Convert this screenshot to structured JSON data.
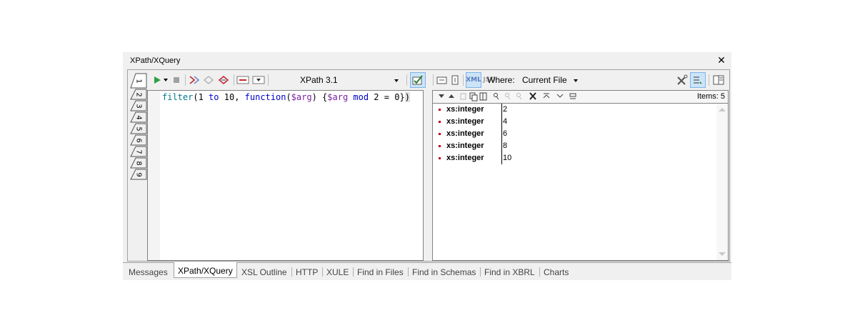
{
  "panel": {
    "title": "XPath/XQuery",
    "close_glyph": "✕"
  },
  "vertical_tabs": [
    "1",
    "2",
    "3",
    "4",
    "5",
    "6",
    "7",
    "8",
    "9"
  ],
  "left_toolbar": {
    "version_select": "XPath 3.1",
    "icons": [
      "run-icon",
      "run-dropdown-icon",
      "stop-icon",
      "step-into-icon",
      "step-over-icon",
      "step-out-icon",
      "builder-mode-icon",
      "evaluator-mode-icon",
      "validate-icon"
    ]
  },
  "editor": {
    "code_tokens": [
      {
        "t": "filter",
        "c": "kw"
      },
      {
        "t": "(",
        "c": "pl"
      },
      {
        "t": "1",
        "c": "num"
      },
      {
        "t": " to ",
        "c": "blue"
      },
      {
        "t": "10",
        "c": "num"
      },
      {
        "t": ", ",
        "c": "pl"
      },
      {
        "t": "function",
        "c": "blue"
      },
      {
        "t": "(",
        "c": "pl"
      },
      {
        "t": "$arg",
        "c": "var"
      },
      {
        "t": ") {",
        "c": "pl"
      },
      {
        "t": "$arg",
        "c": "var"
      },
      {
        "t": " mod ",
        "c": "blue"
      },
      {
        "t": "2",
        "c": "num"
      },
      {
        "t": " = ",
        "c": "pl"
      },
      {
        "t": "0",
        "c": "num"
      },
      {
        "t": "}",
        "c": "pl"
      },
      {
        "t": ")",
        "c": "brk"
      }
    ]
  },
  "right_toolbar": {
    "xml_label": "XML",
    "json_label": "JSO",
    "where_label": "Where:",
    "where_value": "Current File"
  },
  "results": {
    "items_label": "Items: 5",
    "rows": [
      {
        "type": "xs:integer",
        "value": "2"
      },
      {
        "type": "xs:integer",
        "value": "4"
      },
      {
        "type": "xs:integer",
        "value": "6"
      },
      {
        "type": "xs:integer",
        "value": "8"
      },
      {
        "type": "xs:integer",
        "value": "10"
      }
    ]
  },
  "bottom_tabs": [
    "Messages",
    "XPath/XQuery",
    "XSL Outline",
    "HTTP",
    "XULE",
    "Find in Files",
    "Find in Schemas",
    "Find in XBRL",
    "Charts"
  ],
  "active_bottom_tab": "XPath/XQuery",
  "colors": {
    "run_green": "#2ea043",
    "accent_red": "#c00000",
    "highlight_blue": "#cce4f7"
  }
}
